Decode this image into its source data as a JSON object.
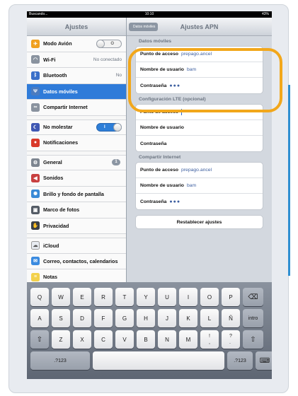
{
  "statusbar": {
    "left": "Buscando...",
    "time": "10:10",
    "battery": "43%"
  },
  "sidebar": {
    "title": "Ajustes",
    "items": [
      {
        "label": "Modo Avión",
        "icon": "airplane-icon",
        "color": "#f0a020",
        "toggle": "off",
        "toggle_text": "O"
      },
      {
        "label": "Wi-Fi",
        "icon": "wifi-icon",
        "color": "#8a939f",
        "value": "No conectado"
      },
      {
        "label": "Bluetooth",
        "icon": "bluetooth-icon",
        "color": "#3a70c9",
        "value": "No"
      },
      {
        "label": "Datos móviles",
        "icon": "antenna-icon",
        "color": "#4a7bc0",
        "selected": true
      },
      {
        "label": "Compartir Internet",
        "icon": "link-icon",
        "color": "#8a939f"
      },
      {
        "label": "No molestar",
        "icon": "moon-icon",
        "color": "#3f58b3",
        "toggle": "on",
        "toggle_text": "I"
      },
      {
        "label": "Notificaciones",
        "icon": "notifications-icon",
        "color": "#d93a2b"
      },
      {
        "label": "General",
        "icon": "gear-icon",
        "color": "#7d8590",
        "badge": "1"
      },
      {
        "label": "Sonidos",
        "icon": "speaker-icon",
        "color": "#c84040"
      },
      {
        "label": "Brillo y fondo de pantalla",
        "icon": "brightness-icon",
        "color": "#3a8ad6"
      },
      {
        "label": "Marco de fotos",
        "icon": "photo-frame-icon",
        "color": "#555c66"
      },
      {
        "label": "Privacidad",
        "icon": "privacy-hand-icon",
        "color": "#3a3f47"
      },
      {
        "label": "iCloud",
        "icon": "cloud-icon",
        "color": "#e8ecf2"
      },
      {
        "label": "Correo, contactos, calendarios",
        "icon": "mail-icon",
        "color": "#3b8be0"
      },
      {
        "label": "Notas",
        "icon": "notes-icon",
        "color": "#f3d14b"
      }
    ]
  },
  "main": {
    "title": "Ajustes APN",
    "back": "Datos móviles",
    "groups": [
      {
        "title": "Datos móviles",
        "rows": [
          {
            "label": "Punto de acceso",
            "value": "prepago.ancel"
          },
          {
            "label": "Nombre de usuario",
            "value": "bam"
          },
          {
            "label": "Contraseña",
            "dots": "●●●"
          }
        ]
      },
      {
        "title": "Configuración LTE (opcional)",
        "rows": [
          {
            "label": "Punto de acceso",
            "caret": true
          },
          {
            "label": "Nombre de usuario"
          },
          {
            "label": "Contraseña"
          }
        ]
      },
      {
        "title": "Compartir Internet",
        "rows": [
          {
            "label": "Punto de acceso",
            "value": "prepago.ancel"
          },
          {
            "label": "Nombre de usuario",
            "value": "bam"
          },
          {
            "label": "Contraseña",
            "dots": "●●●"
          }
        ]
      }
    ],
    "reset_button": "Restablecer ajustes"
  },
  "keyboard": {
    "row1": [
      "Q",
      "W",
      "E",
      "R",
      "T",
      "Y",
      "U",
      "I",
      "O",
      "P",
      "⌫"
    ],
    "row2": [
      "A",
      "S",
      "D",
      "F",
      "G",
      "H",
      "J",
      "K",
      "L",
      "Ñ",
      "intro"
    ],
    "row3": [
      "⇧",
      "Z",
      "X",
      "C",
      "V",
      "B",
      "N",
      "M",
      "!\n,",
      "?\n.",
      "⇧"
    ],
    "row4": [
      ".?123",
      "",
      ".?123",
      "⌨"
    ]
  },
  "colors": {
    "accent": "#2f7bd9",
    "highlight": "#f2a71b"
  }
}
